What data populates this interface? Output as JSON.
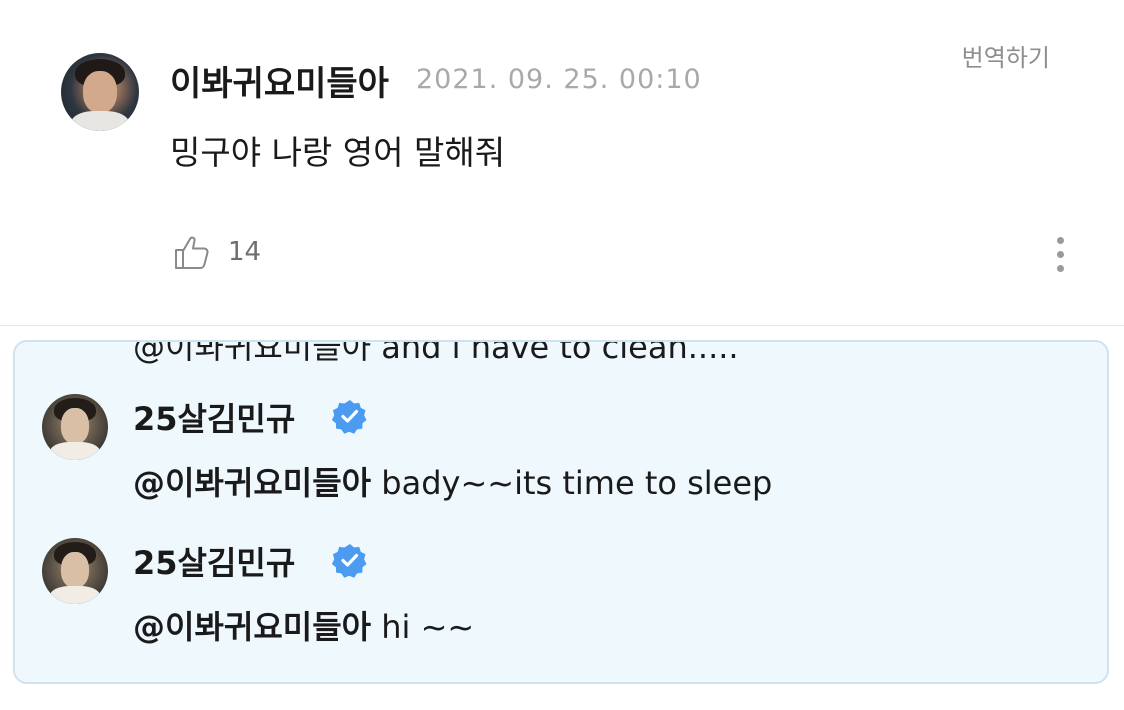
{
  "post": {
    "author": "이봐귀요미들아",
    "timestamp": "2021. 09. 25. 00:10",
    "translate_label": "번역하기",
    "body": "밍구야 나랑 영어 말해줘",
    "like_count": "14"
  },
  "replies": {
    "clipped_text": "@이봐귀요미들아 and i have to clean.....",
    "items": [
      {
        "author": "25살김민규",
        "mention": "@이봐귀요미들아",
        "text": " bady~~its time to sleep"
      },
      {
        "author": "25살김민규",
        "mention": "@이봐귀요미들아",
        "text": " hi ~~"
      }
    ]
  },
  "colors": {
    "verified_badge": "#4b9bf0",
    "reply_background": "#eef8fd",
    "reply_border": "#cfe3ee",
    "timestamp_gray": "#a9a9a9"
  },
  "icons": {
    "like": "thumbs-up-icon",
    "more": "more-vertical-icon",
    "verified": "verified-badge-icon"
  }
}
